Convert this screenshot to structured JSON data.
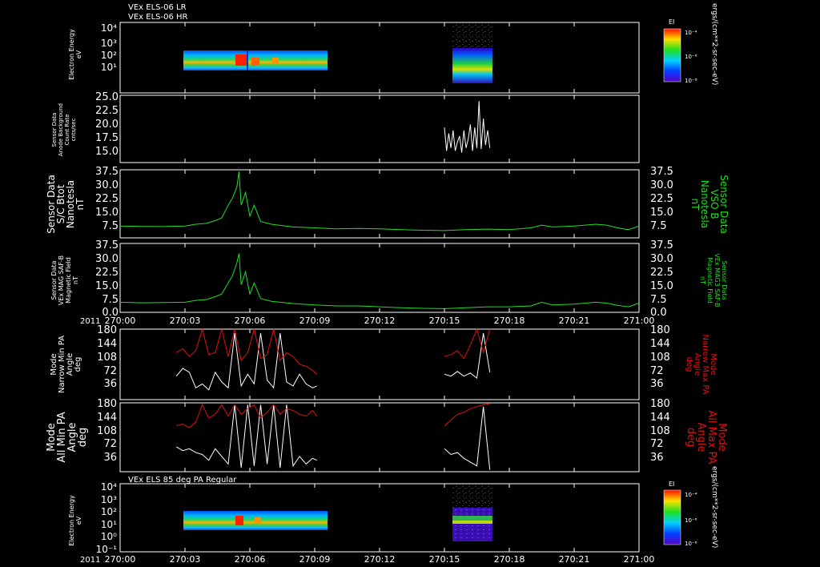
{
  "colors": {
    "background": "#000000",
    "axes": "#ffffff",
    "b_field": "#22dd22",
    "min_pa": "#ffffff",
    "max_pa": "#e01010"
  },
  "header": {
    "title_lr": "VEx ELS-06 LR",
    "title_hr": "VEx ELS-06 HR",
    "title_bottom": "VEx ELS 85 deg PA Regular"
  },
  "colorbar": {
    "label": "EI",
    "ticks": [
      "10⁻⁴",
      "10⁻⁶",
      "10⁻⁸"
    ],
    "unit": "ergs/(cm**2-sr-sec-eV)"
  },
  "time_axis": {
    "year": "2011",
    "tick_labels": [
      "270:00",
      "270:03",
      "270:06",
      "270:09",
      "270:12",
      "270:15",
      "270:18",
      "270:21",
      "271:00"
    ]
  },
  "chart_data": [
    {
      "type": "heatmap",
      "panel": "Electron energy spectrogram (LR/HR)",
      "ylabel": [
        "Electron Energy",
        "eV"
      ],
      "y_scale": "log",
      "y_tick_labels": [
        "10",
        "10²",
        "10³",
        "10⁴"
      ],
      "x_range": [
        "270:00",
        "271:00"
      ],
      "coverage_intervals": [
        [
          "270:02:40",
          "270:09:05"
        ],
        [
          "270:15:00",
          "270:17:05"
        ]
      ]
    },
    {
      "type": "line",
      "panel": "Anode background",
      "ylabel": [
        "Sensor Data",
        "Anode Background",
        "Count Rate",
        "cnts/sec"
      ],
      "ylim": [
        13.5,
        25.0
      ],
      "y_tick_labels": [
        "25.0",
        "22.5",
        "20.0",
        "17.5",
        "15.0"
      ],
      "series": [
        {
          "x_minutes": [
            15.0,
            15.1,
            15.2,
            15.3,
            15.4,
            15.5,
            15.6,
            15.7,
            15.8,
            15.9,
            16.0,
            16.1,
            16.2,
            16.3,
            16.4,
            16.5,
            16.6,
            16.7,
            16.8,
            16.9,
            17.0,
            17.1
          ],
          "y": [
            19.5,
            15.5,
            18.5,
            16.0,
            19.0,
            15.5,
            17.0,
            18.0,
            15.2,
            19.0,
            16.0,
            17.5,
            20.0,
            15.5,
            19.5,
            16.0,
            24.0,
            15.8,
            21.0,
            16.5,
            19.0,
            16.0
          ]
        }
      ]
    },
    {
      "type": "line",
      "panel": "S/C Btot",
      "ylabel": [
        "Sensor Data",
        "S/C Btot",
        "Nanotesla",
        "nT"
      ],
      "ylabel_right": [
        "Sensor Data",
        "VSO B",
        "Nanotesla",
        "nT"
      ],
      "ylim": [
        0,
        37.5
      ],
      "y_tick_labels": [
        "37.5",
        "30.0",
        "22.5",
        "15.0",
        "7.5"
      ],
      "series": [
        {
          "x_minutes": [
            0,
            1,
            2,
            3,
            3.5,
            4,
            4.4,
            4.7,
            5.0,
            5.2,
            5.4,
            5.5,
            5.6,
            5.8,
            6.0,
            6.2,
            6.5,
            7,
            8,
            9,
            10,
            11,
            12,
            13,
            14,
            15,
            16,
            17,
            18,
            19,
            19.5,
            20,
            21,
            22,
            22.5,
            23,
            23.5,
            24
          ],
          "y": [
            6.5,
            6.3,
            6.2,
            6.5,
            7.5,
            8.0,
            9.5,
            11.0,
            18.0,
            22.0,
            28.0,
            36.5,
            18.0,
            25.0,
            12.0,
            18.0,
            9.0,
            7.5,
            6.0,
            5.5,
            5.0,
            5.2,
            5.0,
            4.5,
            4.2,
            4.0,
            4.5,
            4.8,
            4.5,
            5.5,
            7.0,
            6.0,
            6.5,
            7.5,
            7.0,
            5.5,
            4.5,
            6.5
          ]
        }
      ]
    },
    {
      "type": "line",
      "panel": "MAG3 SAF-B",
      "ylabel": [
        "Sensor Data",
        "VEx MAG SAF-B",
        "Magnetic Field",
        "nT"
      ],
      "ylabel_right": [
        "Sensor Data",
        "VEx MAG3 SAF-B",
        "Magnetic Field",
        "nT"
      ],
      "ylim": [
        0,
        37.5
      ],
      "y_tick_labels": [
        "37.5",
        "30.0",
        "22.5",
        "15.0",
        "7.5",
        "0.0"
      ],
      "series": [
        {
          "x_minutes": [
            0,
            1,
            2,
            3,
            3.5,
            4,
            4.4,
            4.7,
            5.0,
            5.2,
            5.4,
            5.5,
            5.6,
            5.8,
            6.0,
            6.2,
            6.5,
            7,
            8,
            9,
            10,
            11,
            12,
            13,
            14,
            15,
            16,
            17,
            18,
            19,
            19.5,
            20,
            21,
            22,
            22.5,
            23,
            23.5,
            24
          ],
          "y": [
            5.5,
            5.2,
            5.3,
            5.5,
            6.5,
            7.0,
            8.5,
            10.0,
            16.0,
            20.0,
            27.0,
            32.0,
            15.0,
            22.0,
            10.0,
            16.0,
            7.5,
            6.0,
            4.8,
            4.0,
            3.5,
            3.5,
            3.0,
            2.5,
            2.2,
            2.0,
            2.5,
            3.0,
            3.0,
            3.5,
            5.5,
            4.0,
            4.5,
            5.5,
            5.0,
            3.8,
            3.0,
            5.0
          ]
        }
      ]
    },
    {
      "type": "line",
      "panel": "Narrow PA",
      "ylabel": [
        "Mode",
        "Narrow Min PA",
        "Angle",
        "deg"
      ],
      "ylabel_right": [
        "Mode",
        "Narrow Max PA",
        "Angle",
        "deg"
      ],
      "ylim": [
        0,
        180
      ],
      "y_tick_labels": [
        "180",
        "144",
        "108",
        "72",
        "36"
      ],
      "series": [
        {
          "name": "Min PA",
          "segments": [
            {
              "x_minutes": [
                2.6,
                2.9,
                3.2,
                3.5,
                3.8,
                4.1,
                4.4,
                4.7,
                5.0,
                5.3,
                5.6,
                5.9,
                6.2,
                6.5,
                6.8,
                7.1,
                7.4,
                7.7,
                8.0,
                8.3,
                8.6,
                8.9,
                9.1
              ],
              "y": [
                60,
                80,
                70,
                30,
                40,
                25,
                70,
                45,
                30,
                170,
                35,
                65,
                40,
                170,
                50,
                30,
                170,
                45,
                35,
                65,
                40,
                30,
                35
              ]
            },
            {
              "x_minutes": [
                15.0,
                15.3,
                15.6,
                15.9,
                16.2,
                16.5,
                16.8,
                17.1
              ],
              "y": [
                65,
                60,
                72,
                60,
                68,
                55,
                170,
                70
              ]
            }
          ]
        },
        {
          "name": "Max PA",
          "segments": [
            {
              "x_minutes": [
                2.6,
                2.9,
                3.2,
                3.5,
                3.8,
                4.1,
                4.4,
                4.7,
                5.0,
                5.3,
                5.6,
                5.9,
                6.2,
                6.5,
                6.8,
                7.1,
                7.4,
                7.7,
                8.0,
                8.3,
                8.6,
                8.9,
                9.1
              ],
              "y": [
                120,
                130,
                110,
                125,
                180,
                115,
                120,
                180,
                110,
                180,
                100,
                120,
                180,
                105,
                115,
                180,
                100,
                120,
                110,
                90,
                85,
                75,
                65
              ]
            },
            {
              "x_minutes": [
                15.0,
                15.3,
                15.6,
                15.9,
                16.2,
                16.5,
                16.8,
                17.1
              ],
              "y": [
                110,
                115,
                125,
                105,
                140,
                180,
                120,
                180
              ]
            }
          ]
        }
      ]
    },
    {
      "type": "line",
      "panel": "All PA",
      "ylabel": [
        "Mode",
        "All Min PA",
        "Angle",
        "deg"
      ],
      "ylabel_right": [
        "Mode",
        "All Max PA",
        "Angle",
        "deg"
      ],
      "ylim": [
        0,
        180
      ],
      "y_tick_labels": [
        "180",
        "144",
        "108",
        "72",
        "36"
      ],
      "series": [
        {
          "name": "Min PA",
          "segments": [
            {
              "x_minutes": [
                2.6,
                2.9,
                3.2,
                3.5,
                3.8,
                4.1,
                4.4,
                4.7,
                5.0,
                5.3,
                5.6,
                5.9,
                6.2,
                6.5,
                6.8,
                7.1,
                7.4,
                7.7,
                8.0,
                8.3,
                8.6,
                8.9,
                9.1
              ],
              "y": [
                65,
                55,
                60,
                50,
                45,
                30,
                60,
                40,
                20,
                175,
                10,
                175,
                15,
                175,
                20,
                175,
                10,
                175,
                15,
                40,
                20,
                35,
                30
              ]
            },
            {
              "x_minutes": [
                15.0,
                15.3,
                15.6,
                15.9,
                16.2,
                16.5,
                16.8,
                17.1
              ],
              "y": [
                60,
                45,
                50,
                35,
                25,
                15,
                170,
                5
              ]
            }
          ]
        },
        {
          "name": "Max PA",
          "segments": [
            {
              "x_minutes": [
                2.6,
                2.9,
                3.2,
                3.5,
                3.8,
                4.1,
                4.4,
                4.7,
                5.0,
                5.3,
                5.6,
                5.9,
                6.2,
                6.5,
                6.8,
                7.1,
                7.4,
                7.7,
                8.0,
                8.3,
                8.6,
                8.9,
                9.1
              ],
              "y": [
                120,
                125,
                115,
                130,
                175,
                140,
                150,
                175,
                145,
                175,
                150,
                165,
                175,
                140,
                155,
                175,
                150,
                165,
                160,
                150,
                145,
                160,
                145
              ]
            },
            {
              "x_minutes": [
                15.0,
                15.3,
                15.6,
                15.9,
                16.2,
                16.5,
                16.8,
                17.1
              ],
              "y": [
                120,
                135,
                150,
                155,
                165,
                170,
                175,
                178
              ]
            }
          ]
        }
      ]
    },
    {
      "type": "heatmap",
      "panel": "Electron energy spectrogram (85 deg PA)",
      "ylabel": [
        "Electron Energy",
        "eV"
      ],
      "y_scale": "log",
      "y_tick_labels": [
        "10⁴",
        "10³",
        "10²",
        "10¹",
        "10⁰",
        "10⁻¹"
      ],
      "x_range": [
        "270:00",
        "271:00"
      ],
      "coverage_intervals": [
        [
          "270:02:40",
          "270:09:05"
        ],
        [
          "270:15:00",
          "270:17:05"
        ]
      ]
    }
  ]
}
